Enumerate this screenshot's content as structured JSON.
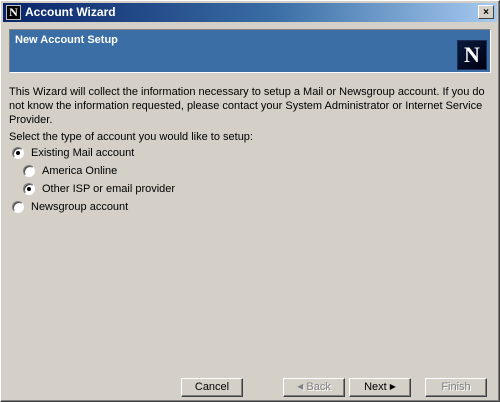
{
  "window": {
    "title": "Account Wizard",
    "app_icon_letter": "N",
    "close_glyph": "×"
  },
  "header": {
    "title": "New Account Setup",
    "logo_letter": "N"
  },
  "intro_text": "This Wizard will collect the information necessary to setup a Mail or Newsgroup account. If you do not know the information requested, please contact your System Administrator or Internet Service Provider.",
  "prompt": "Select the type of account you would like to setup:",
  "options": {
    "existing_mail": {
      "label": "Existing Mail account",
      "checked": true
    },
    "aol": {
      "label": "America Online",
      "checked": false
    },
    "other_isp": {
      "label": "Other ISP or email provider",
      "checked": true
    },
    "newsgroup": {
      "label": "Newsgroup account",
      "checked": false
    }
  },
  "buttons": {
    "cancel": "Cancel",
    "back": "Back",
    "next": "Next",
    "finish": "Finish"
  },
  "colors": {
    "title_gradient_start": "#0a246a",
    "header_band": "#3a6ea5",
    "face": "#d4d0c8"
  }
}
